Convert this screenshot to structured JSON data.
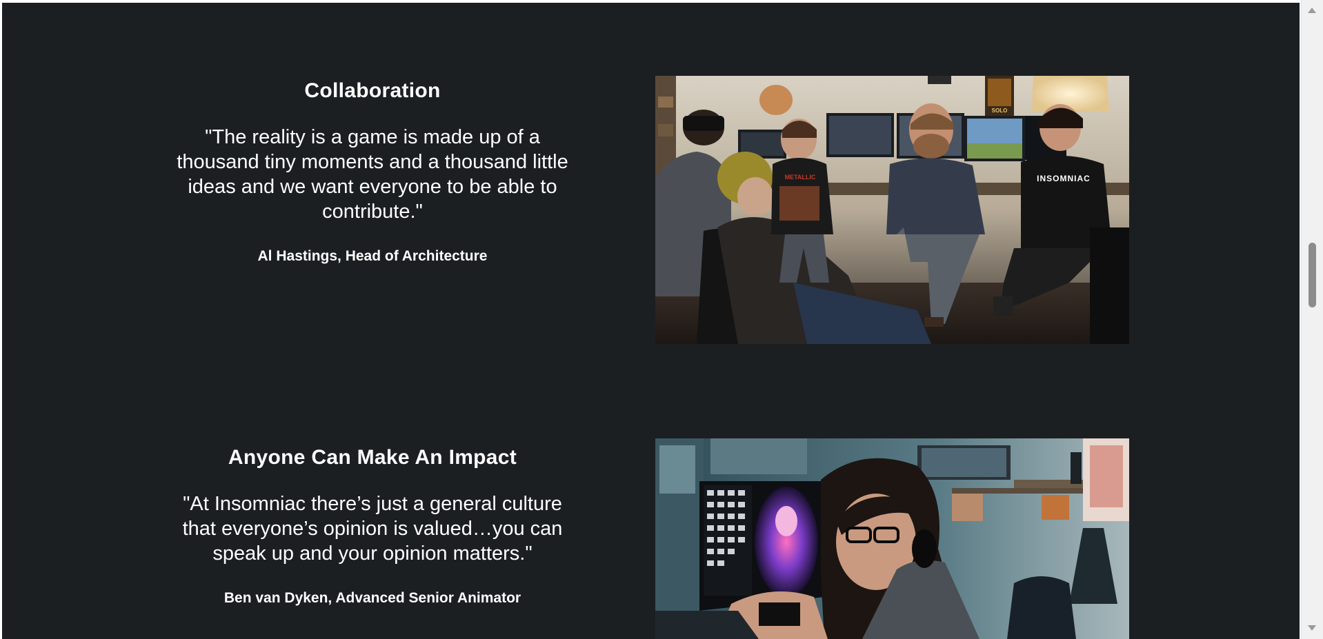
{
  "sections": [
    {
      "heading": "Collaboration",
      "quote": "\"The reality is a game is made up of a thousand tiny moments and a thousand little ideas and we want everyone to be able to contribute.\"",
      "attribution": "Al Hastings, Head of Architecture",
      "photo": {
        "shirt_text": "INSOMNIAC",
        "poster_text": "SOLO"
      }
    },
    {
      "heading": "Anyone Can Make An Impact",
      "quote": "\"At Insomniac there’s just a general culture that everyone’s opinion is valued…you can speak up and your opinion matters.\"",
      "attribution": "Ben van Dyken, Advanced Senior Animator"
    }
  ],
  "colors": {
    "background": "#1b1f22",
    "text": "#ffffff",
    "scrollbar_track": "#f1f1f1",
    "scrollbar_thumb": "#8c8c8c"
  },
  "icons": {
    "scroll_up": "triangle-up",
    "scroll_down": "triangle-down"
  }
}
